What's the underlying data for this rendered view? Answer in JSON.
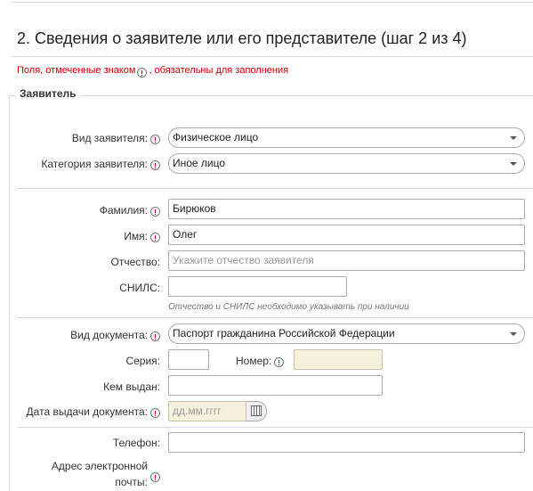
{
  "title": "2. Сведения о заявителе или его представителе (шаг 2 из 4)",
  "required_note": {
    "before": "Поля, отмеченные знаком",
    "after": ", обязательны для заполнения"
  },
  "section_applicant": "Заявитель",
  "fields": {
    "applicant_type": {
      "label": "Вид заявителя:",
      "value": "Физическое лицо"
    },
    "applicant_category": {
      "label": "Категория заявителя:",
      "value": "Иное лицо"
    },
    "last_name": {
      "label": "Фамилия:",
      "value": "Бирюков"
    },
    "first_name": {
      "label": "Имя:",
      "value": "Олег"
    },
    "patronymic": {
      "label": "Отчество:",
      "value": "",
      "placeholder": "Укажите отчество заявителя"
    },
    "snils": {
      "label": "СНИЛС:",
      "value": ""
    },
    "patronymic_hint": "Отчество и СНИЛС необходимо указывать при наличии",
    "doc_type": {
      "label": "Вид документа:",
      "value": "Паспорт гражданина Российской Федерации"
    },
    "series": {
      "label": "Серия:",
      "value": ""
    },
    "number": {
      "label": "Номер:",
      "value": ""
    },
    "issued_by": {
      "label": "Кем выдан:",
      "value": ""
    },
    "issue_date": {
      "label": "Дата выдачи документа:",
      "placeholder": "дд.мм.гггг"
    },
    "phone": {
      "label": "Телефон:",
      "value": ""
    },
    "email": {
      "label_line1": "Адрес электронной",
      "label_line2": "почты:",
      "value": ""
    }
  },
  "icons": {
    "required": "required-marker-icon",
    "dropdown": "chevron-down-icon",
    "calendar": "calendar-icon"
  },
  "colors": {
    "required_red": "#cc0000",
    "readonly_yellow": "#f6f1dc"
  }
}
